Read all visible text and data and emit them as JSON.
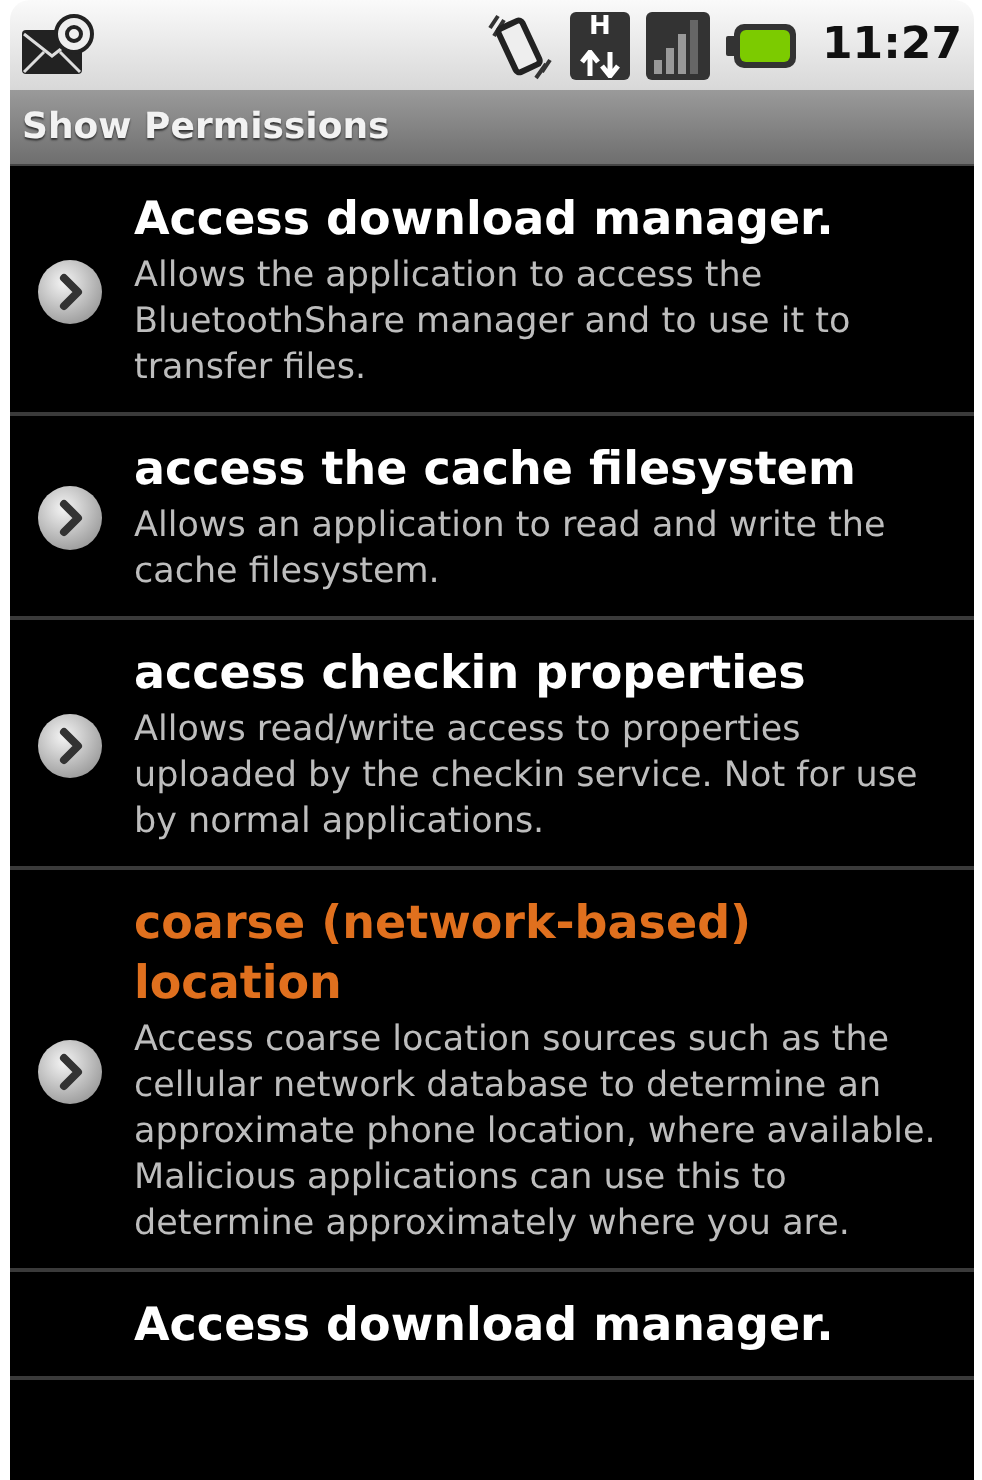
{
  "status_bar": {
    "network_type": "H",
    "time": "11:27"
  },
  "title_bar": {
    "title": "Show Permissions"
  },
  "permissions": [
    {
      "title": "Access download manager.",
      "description": "Allows the application to access the BluetoothShare manager and to use it to transfer files.",
      "dangerous": false
    },
    {
      "title": "access the cache filesystem",
      "description": "Allows an application to read and write the cache filesystem.",
      "dangerous": false
    },
    {
      "title": "access checkin properties",
      "description": "Allows read/write access to properties uploaded by the checkin service. Not for use by normal applications.",
      "dangerous": false
    },
    {
      "title": "coarse (network-based) location",
      "description": "Access coarse location sources such as the cellular network database to determine an approximate phone location, where available. Malicious applications can use this to determine approximately where you are.",
      "dangerous": true
    },
    {
      "title": "Access download manager.",
      "dangerous": false
    }
  ]
}
